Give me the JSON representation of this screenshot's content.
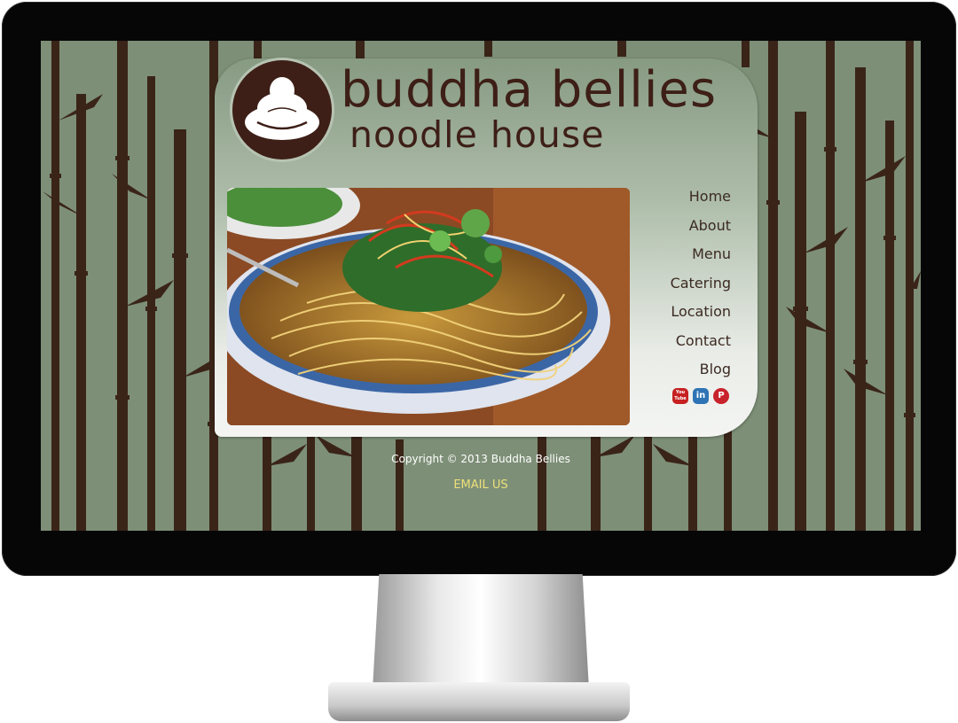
{
  "site": {
    "logo_line1": "buddha bellies",
    "logo_line2": "noodle house"
  },
  "nav": {
    "items": [
      "Home",
      "About",
      "Menu",
      "Catering",
      "Location",
      "Contact",
      "Blog"
    ]
  },
  "social": {
    "icons": [
      "youtube-icon",
      "linkedin-icon",
      "pinterest-icon"
    ],
    "youtube_glyph": "You Tube",
    "linkedin_glyph": "in",
    "pinterest_glyph": "P"
  },
  "footer": {
    "copyright": "Copyright © 2013 Buddha Bellies",
    "email_link": "EMAIL US"
  },
  "colors": {
    "background_green": "#7d8f77",
    "bamboo_brown": "#3a2418",
    "logo_brown": "#3d1f17",
    "email_link": "#ece07a"
  }
}
